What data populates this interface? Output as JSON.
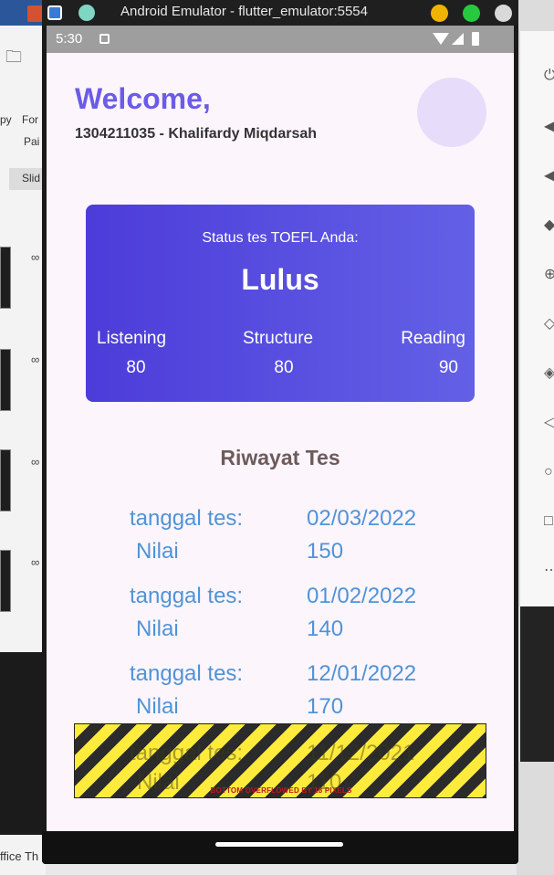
{
  "desktop": {
    "left_tools": [
      "py",
      "For",
      "Pai"
    ],
    "slides_tab": "Slid",
    "status_text": "ffice Th"
  },
  "emulator": {
    "window_title": "Android Emulator - flutter_emulator:5554"
  },
  "phone": {
    "status_time": "5:30",
    "welcome": "Welcome,",
    "user_id": "1304211035 - Khalifardy Miqdarsah",
    "toefl_card": {
      "status_label": "Status tes TOEFL Anda:",
      "status_value": "Lulus",
      "scores": [
        {
          "name": "Listening",
          "value": "80"
        },
        {
          "name": "Structure",
          "value": "80"
        },
        {
          "name": "Reading",
          "value": "90"
        }
      ]
    },
    "history_title": "Riwayat Tes",
    "history": [
      {
        "date_label": "tanggal tes:",
        "date": "02/03/2022",
        "score_label": "Nilai",
        "score": "150"
      },
      {
        "date_label": "tanggal tes:",
        "date": "01/02/2022",
        "score_label": "Nilai",
        "score": "140"
      },
      {
        "date_label": "tanggal tes:",
        "date": "12/01/2022",
        "score_label": "Nilai",
        "score": "170"
      },
      {
        "date_label": "tanggal tes:",
        "date": "11/12/2021",
        "score_label": "Nilai",
        "score": "110"
      }
    ],
    "overflow_message": "BOTTOM OVERFLOWED BY 18 PIXELS"
  }
}
